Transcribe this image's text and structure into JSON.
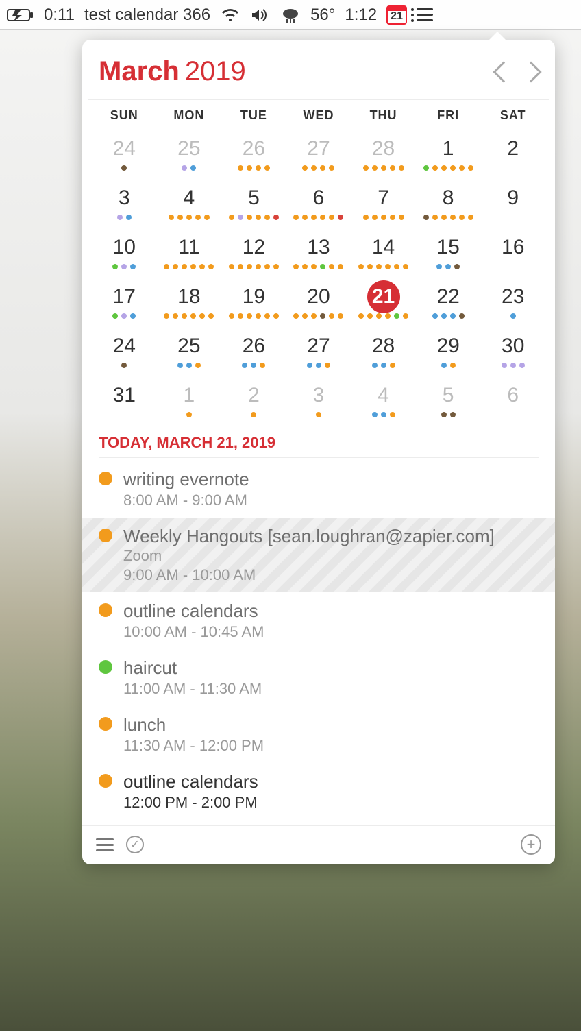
{
  "menubar": {
    "timer": "0:11",
    "event_name": "test calendar 366",
    "temperature": "56°",
    "clock": "1:12",
    "calendar_badge": "21"
  },
  "header": {
    "month": "March",
    "year": "2019"
  },
  "weekdays": [
    "SUN",
    "MON",
    "TUE",
    "WED",
    "THU",
    "FRI",
    "SAT"
  ],
  "weeks": [
    [
      {
        "n": "24",
        "other": true,
        "dots": [
          "brown"
        ]
      },
      {
        "n": "25",
        "other": true,
        "dots": [
          "lav",
          "blue"
        ]
      },
      {
        "n": "26",
        "other": true,
        "dots": [
          "orange",
          "orange",
          "orange",
          "orange"
        ]
      },
      {
        "n": "27",
        "other": true,
        "dots": [
          "orange",
          "orange",
          "orange",
          "orange"
        ]
      },
      {
        "n": "28",
        "other": true,
        "dots": [
          "orange",
          "orange",
          "orange",
          "orange",
          "orange"
        ]
      },
      {
        "n": "1",
        "dots": [
          "green",
          "orange",
          "orange",
          "orange",
          "orange",
          "orange"
        ]
      },
      {
        "n": "2",
        "dots": []
      }
    ],
    [
      {
        "n": "3",
        "dots": [
          "lav",
          "blue"
        ]
      },
      {
        "n": "4",
        "dots": [
          "orange",
          "orange",
          "orange",
          "orange",
          "orange"
        ]
      },
      {
        "n": "5",
        "dots": [
          "orange",
          "lav",
          "orange",
          "orange",
          "orange",
          "red"
        ]
      },
      {
        "n": "6",
        "dots": [
          "orange",
          "orange",
          "orange",
          "orange",
          "orange",
          "red"
        ]
      },
      {
        "n": "7",
        "dots": [
          "orange",
          "orange",
          "orange",
          "orange",
          "orange"
        ]
      },
      {
        "n": "8",
        "dots": [
          "brown",
          "orange",
          "orange",
          "orange",
          "orange",
          "orange"
        ]
      },
      {
        "n": "9",
        "dots": []
      }
    ],
    [
      {
        "n": "10",
        "dots": [
          "green",
          "lav",
          "blue"
        ]
      },
      {
        "n": "11",
        "dots": [
          "orange",
          "orange",
          "orange",
          "orange",
          "orange",
          "orange"
        ]
      },
      {
        "n": "12",
        "dots": [
          "orange",
          "orange",
          "orange",
          "orange",
          "orange",
          "orange"
        ]
      },
      {
        "n": "13",
        "dots": [
          "orange",
          "orange",
          "orange",
          "green",
          "orange",
          "orange"
        ]
      },
      {
        "n": "14",
        "dots": [
          "orange",
          "orange",
          "orange",
          "orange",
          "orange",
          "orange"
        ]
      },
      {
        "n": "15",
        "dots": [
          "blue",
          "blue",
          "brown"
        ]
      },
      {
        "n": "16",
        "dots": []
      }
    ],
    [
      {
        "n": "17",
        "dots": [
          "green",
          "lav",
          "blue"
        ]
      },
      {
        "n": "18",
        "dots": [
          "orange",
          "orange",
          "orange",
          "orange",
          "orange",
          "orange"
        ]
      },
      {
        "n": "19",
        "dots": [
          "orange",
          "orange",
          "orange",
          "orange",
          "orange",
          "orange"
        ]
      },
      {
        "n": "20",
        "dots": [
          "orange",
          "orange",
          "orange",
          "brown",
          "orange",
          "orange"
        ]
      },
      {
        "n": "21",
        "today": true,
        "dots": [
          "orange",
          "orange",
          "orange",
          "orange",
          "green",
          "orange"
        ]
      },
      {
        "n": "22",
        "dots": [
          "blue",
          "blue",
          "blue",
          "brown"
        ]
      },
      {
        "n": "23",
        "dots": [
          "blue"
        ]
      }
    ],
    [
      {
        "n": "24",
        "dots": [
          "brown"
        ]
      },
      {
        "n": "25",
        "dots": [
          "blue",
          "blue",
          "orange"
        ]
      },
      {
        "n": "26",
        "dots": [
          "blue",
          "blue",
          "orange"
        ]
      },
      {
        "n": "27",
        "dots": [
          "blue",
          "blue",
          "orange"
        ]
      },
      {
        "n": "28",
        "dots": [
          "blue",
          "blue",
          "orange"
        ]
      },
      {
        "n": "29",
        "dots": [
          "blue",
          "orange"
        ]
      },
      {
        "n": "30",
        "dots": [
          "lav",
          "lav",
          "lav"
        ]
      }
    ],
    [
      {
        "n": "31",
        "dots": []
      },
      {
        "n": "1",
        "other": true,
        "dots": [
          "orange"
        ]
      },
      {
        "n": "2",
        "other": true,
        "dots": [
          "orange"
        ]
      },
      {
        "n": "3",
        "other": true,
        "dots": [
          "orange"
        ]
      },
      {
        "n": "4",
        "other": true,
        "dots": [
          "blue",
          "blue",
          "orange"
        ]
      },
      {
        "n": "5",
        "other": true,
        "dots": [
          "brown",
          "brown"
        ]
      },
      {
        "n": "6",
        "other": true,
        "dots": []
      }
    ]
  ],
  "today_heading": "TODAY, MARCH 21, 2019",
  "events": [
    {
      "color": "orange",
      "title": "writing evernote",
      "time": "8:00 AM - 9:00 AM",
      "past": true
    },
    {
      "color": "orange",
      "title": "Weekly Hangouts [sean.loughran@zapier.com]",
      "location": "Zoom",
      "time": "9:00 AM - 10:00 AM",
      "striped": true,
      "past": true
    },
    {
      "color": "orange",
      "title": "outline calendars",
      "time": "10:00 AM - 10:45 AM",
      "past": true
    },
    {
      "color": "green",
      "title": "haircut",
      "time": "11:00 AM - 11:30 AM",
      "past": true
    },
    {
      "color": "orange",
      "title": "lunch",
      "time": "11:30 AM - 12:00 PM",
      "past": true
    },
    {
      "color": "orange",
      "title": "outline calendars",
      "time": "12:00 PM - 2:00 PM",
      "upcoming": true
    }
  ]
}
